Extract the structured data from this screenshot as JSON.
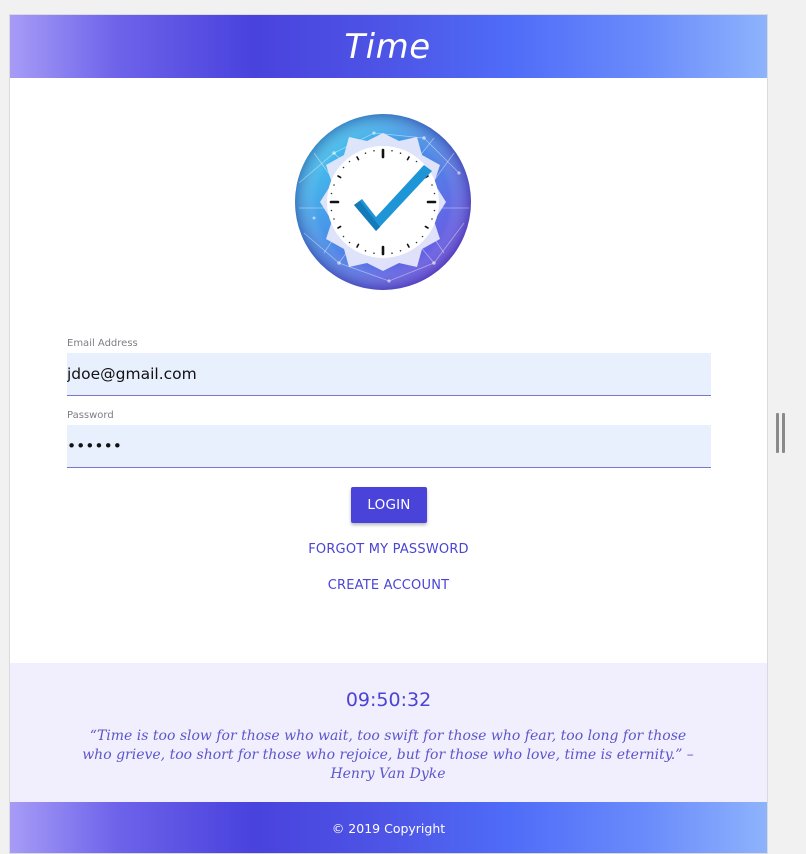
{
  "header": {
    "title": "Time"
  },
  "form": {
    "email": {
      "label": "Email Address",
      "value": "jdoe@gmail.com"
    },
    "password": {
      "label": "Password",
      "value": "••••••"
    },
    "login_label": "LOGIN"
  },
  "links": {
    "forgot_password": "FORGOT MY PASSWORD",
    "create_account": "CREATE ACCOUNT"
  },
  "quote_panel": {
    "time": "09:50:32",
    "quote": "“Time is too slow for those who wait, too swift for those who fear, too long for those who grieve, too short for those who rejoice, but for those who love, time is eternity.” – Henry Van Dyke"
  },
  "footer": {
    "copyright": "© 2019 Copyright"
  },
  "icons": {
    "logo": "clock-checkmark-globe-icon",
    "splitter": "splitter-handle-icon"
  },
  "colors": {
    "brand": "#4a43d9",
    "link": "#4a44d4",
    "input_background": "#e8effd",
    "quote_background": "#f1effd"
  }
}
